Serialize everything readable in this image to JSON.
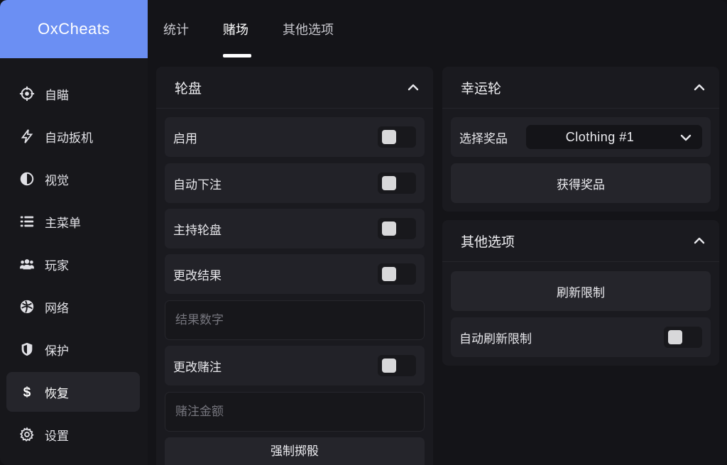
{
  "app": {
    "title": "OxCheats"
  },
  "tabs": [
    {
      "label": "统计",
      "active": false
    },
    {
      "label": "赌场",
      "active": true
    },
    {
      "label": "其他选项",
      "active": false
    }
  ],
  "sidebar": {
    "items": [
      {
        "label": "自瞄",
        "icon": "crosshair-icon",
        "active": false
      },
      {
        "label": "自动扳机",
        "icon": "lightning-icon",
        "active": false
      },
      {
        "label": "视觉",
        "icon": "half-circle-icon",
        "active": false
      },
      {
        "label": "主菜单",
        "icon": "list-icon",
        "active": false
      },
      {
        "label": "玩家",
        "icon": "users-icon",
        "active": false
      },
      {
        "label": "网络",
        "icon": "globe-icon",
        "active": false
      },
      {
        "label": "保护",
        "icon": "shield-icon",
        "active": false
      },
      {
        "label": "恢复",
        "icon": "dollar-icon",
        "active": true
      },
      {
        "label": "设置",
        "icon": "gear-icon",
        "active": false
      }
    ]
  },
  "roulette": {
    "title": "轮盘",
    "enable": {
      "label": "启用",
      "checked": false
    },
    "auto_bet": {
      "label": "自动下注",
      "checked": false
    },
    "host_roulette": {
      "label": "主持轮盘",
      "checked": false
    },
    "change_result": {
      "label": "更改结果",
      "checked": false
    },
    "result_number": {
      "placeholder": "结果数字",
      "value": ""
    },
    "change_bet": {
      "label": "更改赌注",
      "checked": false
    },
    "bet_amount": {
      "placeholder": "赌注金额",
      "value": ""
    },
    "force_roll_label": "强制掷骰"
  },
  "lucky_wheel": {
    "title": "幸运轮",
    "select_prize_label": "选择奖品",
    "selected_prize": "Clothing #1",
    "get_prize_label": "获得奖品"
  },
  "other_options": {
    "title": "其他选项",
    "refresh_limit_label": "刷新限制",
    "auto_refresh": {
      "label": "自动刷新限制",
      "checked": false
    }
  },
  "colors": {
    "accent": "#6b8ff3",
    "background": "#141418",
    "panel": "#1a1a1f",
    "row": "#222228"
  }
}
